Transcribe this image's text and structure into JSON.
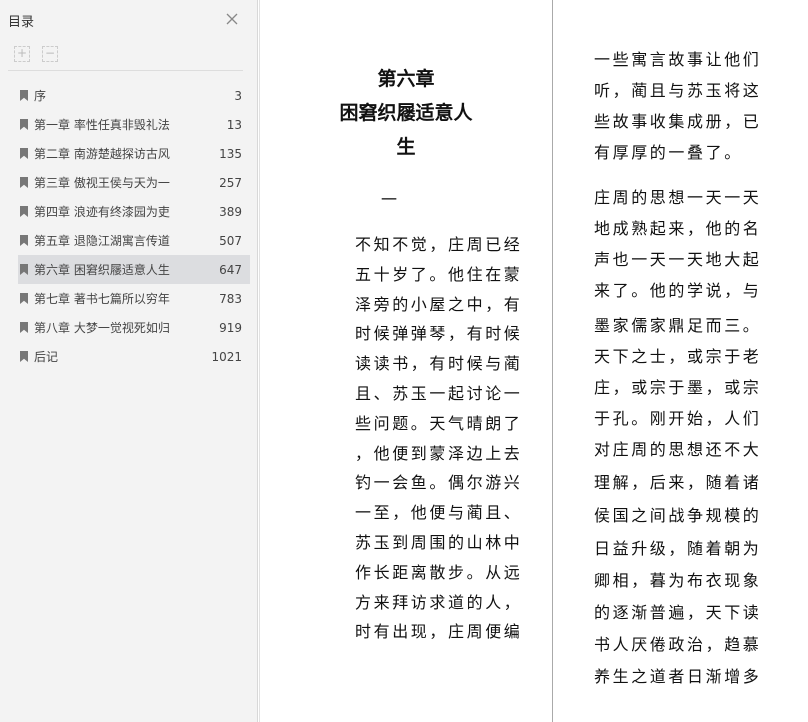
{
  "sidebar": {
    "title": "目录",
    "expand_all": "+",
    "collapse_all": "−",
    "items": [
      {
        "label": "序",
        "page": "3"
      },
      {
        "label": "第一章 率性任真非毁礼法",
        "page": "13"
      },
      {
        "label": "第二章 南游楚越探访古风",
        "page": "135"
      },
      {
        "label": "第三章 傲视王侯与天为一",
        "page": "257"
      },
      {
        "label": "第四章 浪迹有终漆园为吏",
        "page": "389"
      },
      {
        "label": "第五章 退隐江湖寓言传道",
        "page": "507"
      },
      {
        "label": "第六章 困窘织屦适意人生",
        "page": "647",
        "active": true
      },
      {
        "label": "第七章 著书七篇所以穷年",
        "page": "783"
      },
      {
        "label": "第八章 大梦一觉视死如归",
        "page": "919"
      },
      {
        "label": "后记",
        "page": "1021"
      }
    ]
  },
  "page1": {
    "chapter": "第六章",
    "title_line1": "困窘织屦适意人",
    "title_line2": "生",
    "section": "一",
    "lines": [
      "不知不觉，庄周已经",
      "五十岁了。他住在蒙",
      "泽旁的小屋之中，有",
      "时候弹弹琴，有时候",
      "读读书，有时候与蔺",
      "且、苏玉一起讨论一",
      "些问题。天气晴朗了",
      "，他便到蒙泽边上去",
      "钓一会鱼。偶尔游兴",
      "一至，他便与蔺且、",
      "苏玉到周围的山林中",
      "作长距离散步。从远",
      "方来拜访求道的人，",
      "时有出现，庄周便编"
    ]
  },
  "page2": {
    "lines": [
      "一些寓言故事让他们",
      "听，蔺且与苏玉将这",
      "些故事收集成册，已",
      "有厚厚的一叠了。",
      "庄周的思想一天一天",
      "地成熟起来，他的名",
      "声也一天一天地大起",
      "来了。他的学说，与",
      "墨家儒家鼎足而三。",
      "天下之士，或宗于老",
      "庄，或宗于墨，或宗",
      "于孔。刚开始，人们",
      "对庄周的思想还不大",
      "理解，后来，随着诸",
      "侯国之间战争规模的",
      "日益升级，随着朝为",
      "卿相，暮为布衣现象",
      "的逐渐普遍，天下读",
      "书人厌倦政治，趋慕",
      "养生之道者日渐增多"
    ]
  }
}
